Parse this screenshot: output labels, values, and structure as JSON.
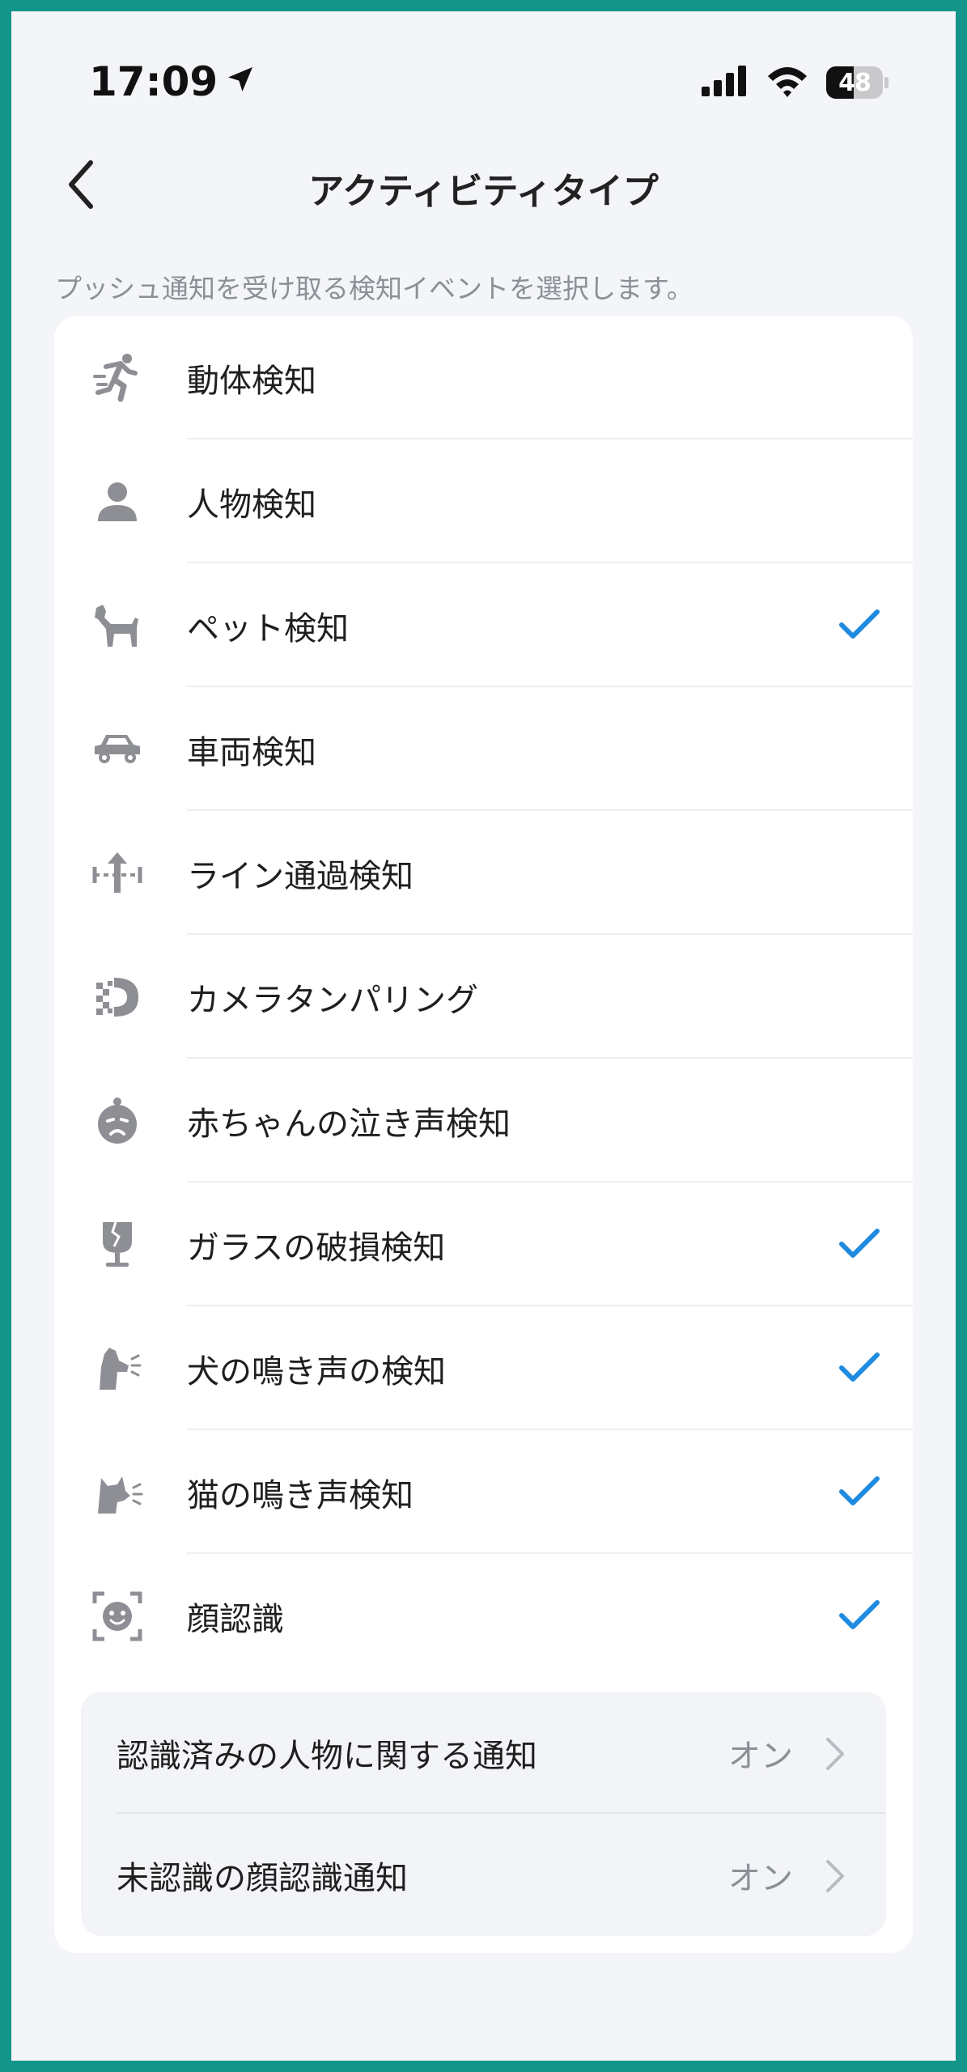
{
  "status_bar": {
    "time": "17:09",
    "battery": "48",
    "battery_level_pct": 48
  },
  "header": {
    "title": "アクティビティタイプ",
    "subtitle": "プッシュ通知を受け取る検知イベントを選択します。"
  },
  "items": [
    {
      "label": "動体検知",
      "icon": "running-person-icon",
      "checked": false
    },
    {
      "label": "人物検知",
      "icon": "person-icon",
      "checked": false
    },
    {
      "label": "ペット検知",
      "icon": "dog-icon",
      "checked": true
    },
    {
      "label": "車両検知",
      "icon": "car-icon",
      "checked": false
    },
    {
      "label": "ライン通過検知",
      "icon": "line-crossing-icon",
      "checked": false
    },
    {
      "label": "カメラタンパリング",
      "icon": "camera-tampering-icon",
      "checked": false
    },
    {
      "label": "赤ちゃんの泣き声検知",
      "icon": "baby-cry-icon",
      "checked": false
    },
    {
      "label": "ガラスの破損検知",
      "icon": "broken-glass-icon",
      "checked": true
    },
    {
      "label": "犬の鳴き声の検知",
      "icon": "dog-bark-icon",
      "checked": true
    },
    {
      "label": "猫の鳴き声検知",
      "icon": "cat-meow-icon",
      "checked": true
    },
    {
      "label": "顔認識",
      "icon": "face-recognition-icon",
      "checked": true
    }
  ],
  "face_settings": [
    {
      "label": "認識済みの人物に関する通知",
      "value": "オン"
    },
    {
      "label": "未認識の顔認識通知",
      "value": "オン"
    }
  ],
  "colors": {
    "accent": "#1f8be0",
    "icon": "#8d8f94",
    "frame": "#13958a"
  }
}
